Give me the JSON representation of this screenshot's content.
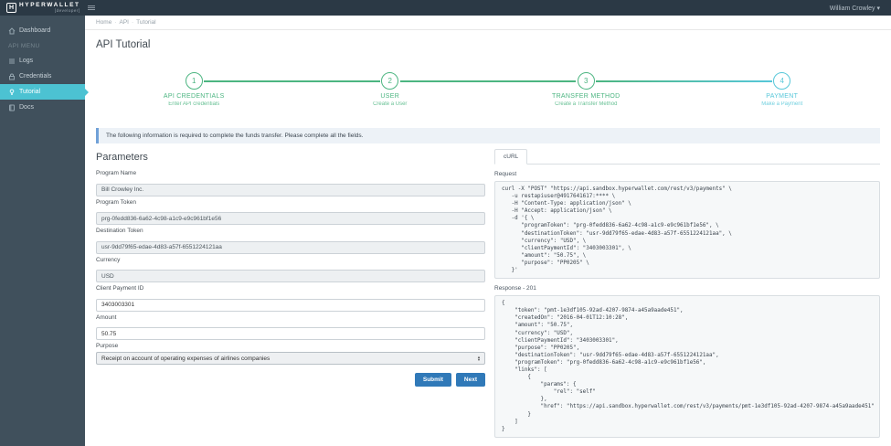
{
  "header": {
    "brand": "HYPERWALLET",
    "brand_sub": "[developer]",
    "brand_initial": "H",
    "user": "William Crowley ▾"
  },
  "sidebar": {
    "items": [
      {
        "label": "Dashboard",
        "icon": "home"
      },
      {
        "label": "API MENU",
        "icon": null
      },
      {
        "label": "Logs",
        "icon": "list"
      },
      {
        "label": "Credentials",
        "icon": "lock"
      },
      {
        "label": "Tutorial",
        "icon": "lightbulb",
        "active": true
      },
      {
        "label": "Docs",
        "icon": "book"
      }
    ]
  },
  "breadcrumb": {
    "home": "Home",
    "section": "API",
    "current": "Tutorial",
    "separator": "·"
  },
  "page_title": "API Tutorial",
  "stepper": {
    "steps": [
      {
        "number": "1",
        "title": "API CREDENTIALS",
        "subtitle": "Enter API credentials",
        "color": "#4cb581"
      },
      {
        "number": "2",
        "title": "USER",
        "subtitle": "Create a User",
        "color": "#4cb581"
      },
      {
        "number": "3",
        "title": "TRANSFER METHOD",
        "subtitle": "Create a Transfer Method",
        "color": "#4cb581"
      },
      {
        "number": "4",
        "title": "PAYMENT",
        "subtitle": "Make a Payment",
        "color": "#57c7d9"
      }
    ]
  },
  "notice": "The following information is required to complete the funds transfer. Please complete all the fields.",
  "form": {
    "heading": "Parameters",
    "fields": [
      {
        "label": "Program Name",
        "value": "Bill Crowley Inc.",
        "disabled": true
      },
      {
        "label": "Program Token",
        "value": "prg-0fedd836-6a62-4c98-a1c9-e9c961bf1e56",
        "disabled": true
      },
      {
        "label": "Destination Token",
        "value": "usr-9dd79f65-edae-4d83-a57f-6551224121aa",
        "disabled": true
      },
      {
        "label": "Currency",
        "value": "USD",
        "disabled": true
      },
      {
        "label": "Client Payment ID",
        "value": "3403003301",
        "disabled": false
      },
      {
        "label": "Amount",
        "value": "50.75",
        "disabled": false
      },
      {
        "label": "Purpose",
        "value": "Receipt on account of operating expenses of airlines companies",
        "type": "select"
      }
    ],
    "submit_label": "Submit",
    "next_label": "Next"
  },
  "code_panel": {
    "tab": "cURL",
    "request_label": "Request",
    "request_code": "curl -X \"POST\" \"https://api.sandbox.hyperwallet.com/rest/v3/payments\" \\\n   -u restapiuser@4917641617:**** \\\n   -H \"Content-Type: application/json\" \\\n   -H \"Accept: application/json\" \\\n   -d '{ \\\n      \"programToken\": \"prg-0fedd836-6a62-4c98-a1c9-e9c961bf1e56\", \\\n      \"destinationToken\": \"usr-9dd79f65-edae-4d83-a57f-6551224121aa\", \\\n      \"currency\": \"USD\", \\\n      \"clientPaymentId\": \"3403003301\", \\\n      \"amount\": \"50.75\", \\\n      \"purpose\": \"PP0205\" \\\n   }'",
    "response_label": "Response - 201",
    "response_code": "{\n    \"token\": \"pmt-1e3df105-92ad-4207-9874-a45a9aade451\",\n    \"createdOn\": \"2016-04-01T12:10:28\",\n    \"amount\": \"50.75\",\n    \"currency\": \"USD\",\n    \"clientPaymentId\": \"3403003301\",\n    \"purpose\": \"PP0205\",\n    \"destinationToken\": \"usr-9dd79f65-edae-4d83-a57f-6551224121aa\",\n    \"programToken\": \"prg-0fedd836-6a62-4c98-a1c9-e9c961bf1e56\",\n    \"links\": [\n        {\n            \"params\": {\n                \"rel\": \"self\"\n            },\n            \"href\": \"https://api.sandbox.hyperwallet.com/rest/v3/payments/pmt-1e3df105-92ad-4207-9874-a45a9aade451\"\n        }\n    ]\n}"
  },
  "colors": {
    "topbar_bg": "#2b3945",
    "sidebar_bg": "#40505c",
    "nav_active": "#4cc2d2",
    "step_green": "#4cb581",
    "step_cyan": "#57c7d9",
    "button_blue": "#3079b8",
    "notice_border": "#71a1d8"
  }
}
